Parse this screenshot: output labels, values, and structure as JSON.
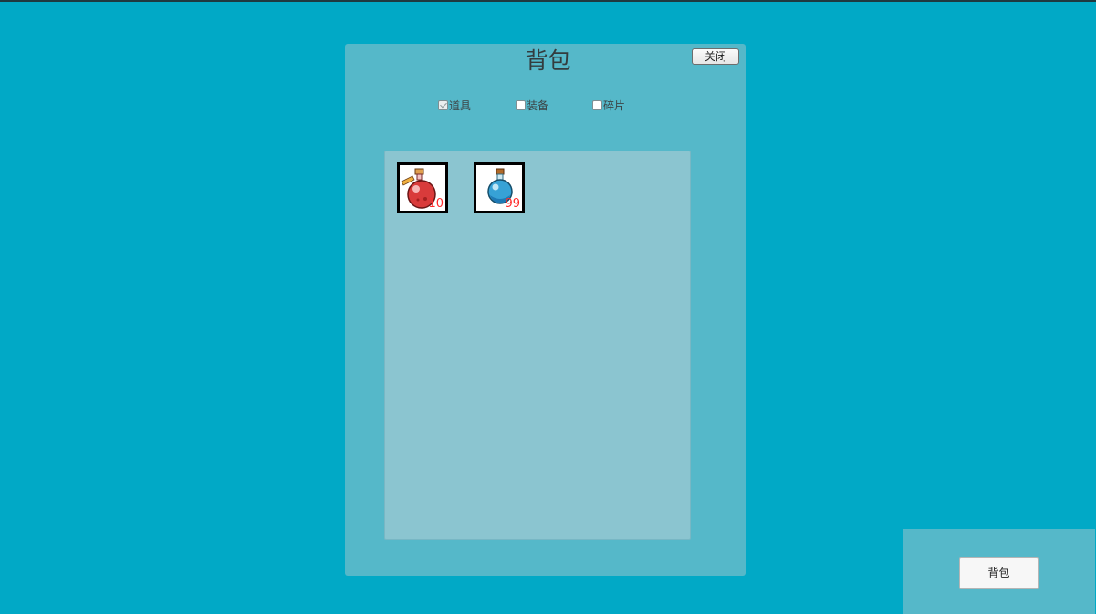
{
  "bag_panel": {
    "title": "背包",
    "close_label": "关闭",
    "filters": [
      {
        "label": "道具",
        "checked": true
      },
      {
        "label": "装备",
        "checked": false
      },
      {
        "label": "碎片",
        "checked": false
      }
    ],
    "items": [
      {
        "name": "red-potion",
        "icon": "red-potion-icon",
        "count": "10"
      },
      {
        "name": "blue-potion",
        "icon": "blue-potion-icon",
        "count": "99"
      }
    ]
  },
  "bottom_bar": {
    "bag_button_label": "背包"
  },
  "colors": {
    "background": "#01a9c6",
    "panel": "#55b8c9",
    "grid": "#8bc5d0",
    "count_text": "#ff2a2a"
  }
}
